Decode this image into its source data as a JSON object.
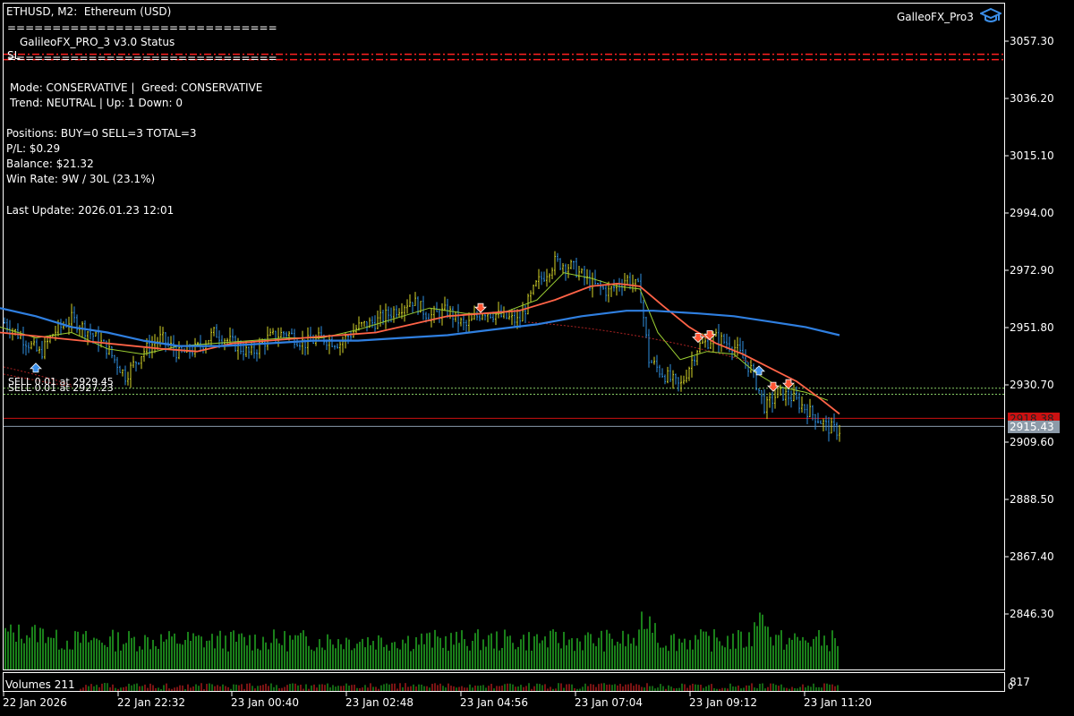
{
  "window": {
    "symbol_title": "ETHUSD, M2:  Ethereum (USD)",
    "ea_name": "GalleoFX_Pro3"
  },
  "status_panel": {
    "sep_top": "==============================",
    "title": "GalileoFX_PRO_3 v3.0 Status",
    "sl_marker": "SL",
    "sep_bottom": "==============================",
    "mode_line": "Mode: CONSERVATIVE |  Greed: CONSERVATIVE",
    "trend_line": "Trend: NEUTRAL | Up: 1 Down: 0",
    "positions_line": "Positions: BUY=0 SELL=3 TOTAL=3",
    "pl_line": "P/L: $0.29",
    "balance_line": "Balance: $21.32",
    "winrate_line": "Win Rate: 9W / 30L (23.1%)",
    "update_line": "Last Update: 2026.01.23 12:01"
  },
  "trade_labels": {
    "line1": "SELL 0.01 at 2929.45",
    "line2": "SELL 0.01 at 2927.23"
  },
  "price_axis": {
    "labels": [
      "3057.30",
      "3036.20",
      "3015.10",
      "2994.00",
      "2972.90",
      "2951.80",
      "2930.70",
      "2909.60",
      "2888.50",
      "2867.40",
      "2846.30"
    ],
    "current_bid": "2915.43",
    "current_ask": "2918.38",
    "volume_scale": "817",
    "volume_zero": "0"
  },
  "time_axis": {
    "labels": [
      "22 Jan 2026",
      "22 Jan 22:32",
      "23 Jan 00:40",
      "23 Jan 02:48",
      "23 Jan 04:56",
      "23 Jan 07:04",
      "23 Jan 09:12",
      "23 Jan 11:20"
    ]
  },
  "volume_panel": {
    "label": "Volumes 211"
  },
  "colors": {
    "bull_bar": "#d4d42a",
    "bear_bar": "#2f8fe0",
    "ma_fast": "#9acd32",
    "ma_mid": "#ff6347",
    "ma_slow": "#2f7fe0",
    "sl_line": "#ff2020",
    "ask_line": "#cc1111",
    "bid_line": "#8899aa",
    "volume_bar": "#22aa22",
    "trade_line": "#88cc66"
  },
  "icons": {
    "ea_icon": "graduation-cap-icon",
    "sell_arrow": "sell-arrow-icon",
    "buy_arrow": "buy-arrow-icon"
  },
  "chart_data": {
    "type": "candlestick",
    "symbol": "ETHUSD",
    "timeframe": "M2",
    "ylim": [
      2836,
      3068
    ],
    "price_ticks": [
      3057.3,
      3036.2,
      3015.1,
      2994.0,
      2972.9,
      2951.8,
      2930.7,
      2909.6,
      2888.5,
      2867.4,
      2846.3
    ],
    "anchors": [
      [
        0,
        2955
      ],
      [
        25,
        2948
      ],
      [
        45,
        2942
      ],
      [
        60,
        2950
      ],
      [
        80,
        2955
      ],
      [
        100,
        2950
      ],
      [
        120,
        2944
      ],
      [
        140,
        2934
      ],
      [
        160,
        2943
      ],
      [
        180,
        2948
      ],
      [
        200,
        2942
      ],
      [
        220,
        2944
      ],
      [
        240,
        2950
      ],
      [
        260,
        2946
      ],
      [
        280,
        2942
      ],
      [
        300,
        2948
      ],
      [
        320,
        2950
      ],
      [
        340,
        2946
      ],
      [
        360,
        2948
      ],
      [
        380,
        2946
      ],
      [
        400,
        2952
      ],
      [
        420,
        2954
      ],
      [
        440,
        2958
      ],
      [
        460,
        2962
      ],
      [
        480,
        2956
      ],
      [
        500,
        2958
      ],
      [
        520,
        2952
      ],
      [
        540,
        2958
      ],
      [
        560,
        2956
      ],
      [
        580,
        2954
      ],
      [
        600,
        2968
      ],
      [
        620,
        2976
      ],
      [
        640,
        2974
      ],
      [
        660,
        2968
      ],
      [
        680,
        2965
      ],
      [
        700,
        2970
      ],
      [
        715,
        2966
      ],
      [
        725,
        2940
      ],
      [
        740,
        2935
      ],
      [
        760,
        2930
      ],
      [
        780,
        2945
      ],
      [
        800,
        2948
      ],
      [
        820,
        2945
      ],
      [
        840,
        2936
      ],
      [
        855,
        2922
      ],
      [
        870,
        2928
      ],
      [
        885,
        2926
      ],
      [
        900,
        2922
      ],
      [
        915,
        2918
      ],
      [
        925,
        2915
      ],
      [
        935,
        2914
      ]
    ],
    "ma_fast_points": [
      [
        0,
        2952
      ],
      [
        40,
        2948
      ],
      [
        80,
        2950
      ],
      [
        120,
        2944
      ],
      [
        160,
        2942
      ],
      [
        200,
        2945
      ],
      [
        240,
        2946
      ],
      [
        280,
        2947
      ],
      [
        320,
        2948
      ],
      [
        360,
        2948
      ],
      [
        400,
        2951
      ],
      [
        440,
        2955
      ],
      [
        480,
        2959
      ],
      [
        520,
        2957
      ],
      [
        560,
        2957
      ],
      [
        600,
        2962
      ],
      [
        630,
        2972
      ],
      [
        660,
        2970
      ],
      [
        690,
        2967
      ],
      [
        715,
        2966
      ],
      [
        735,
        2950
      ],
      [
        760,
        2940
      ],
      [
        790,
        2943
      ],
      [
        820,
        2942
      ],
      [
        845,
        2935
      ],
      [
        870,
        2930
      ],
      [
        900,
        2928
      ],
      [
        925,
        2925
      ]
    ],
    "ma_mid_points": [
      [
        0,
        2950
      ],
      [
        60,
        2948
      ],
      [
        120,
        2946
      ],
      [
        180,
        2944
      ],
      [
        220,
        2943
      ],
      [
        260,
        2946
      ],
      [
        300,
        2947
      ],
      [
        340,
        2948
      ],
      [
        380,
        2949
      ],
      [
        420,
        2950
      ],
      [
        460,
        2953
      ],
      [
        500,
        2956
      ],
      [
        540,
        2957
      ],
      [
        580,
        2958
      ],
      [
        620,
        2962
      ],
      [
        660,
        2967
      ],
      [
        690,
        2968
      ],
      [
        715,
        2967
      ],
      [
        740,
        2960
      ],
      [
        770,
        2952
      ],
      [
        800,
        2946
      ],
      [
        830,
        2942
      ],
      [
        860,
        2937
      ],
      [
        890,
        2932
      ],
      [
        915,
        2926
      ],
      [
        938,
        2920
      ]
    ],
    "ma_slow_points": [
      [
        0,
        2959
      ],
      [
        40,
        2956
      ],
      [
        80,
        2952
      ],
      [
        120,
        2950
      ],
      [
        160,
        2947
      ],
      [
        200,
        2945
      ],
      [
        250,
        2945
      ],
      [
        300,
        2946
      ],
      [
        350,
        2947
      ],
      [
        400,
        2947
      ],
      [
        450,
        2948
      ],
      [
        500,
        2949
      ],
      [
        550,
        2951
      ],
      [
        600,
        2953
      ],
      [
        650,
        2956
      ],
      [
        700,
        2958
      ],
      [
        730,
        2958
      ],
      [
        780,
        2957
      ],
      [
        820,
        2956
      ],
      [
        860,
        2954
      ],
      [
        900,
        2952
      ],
      [
        938,
        2949
      ]
    ],
    "sl_level": 3051.5,
    "ask_level": 2918.38,
    "bid_level": 2915.43,
    "trade_levels": [
      2929.45,
      2927.23
    ],
    "sell_signals": [
      [
        537,
        2958
      ],
      [
        780,
        2947
      ],
      [
        793,
        2948
      ],
      [
        864,
        2929
      ],
      [
        881,
        2930
      ]
    ],
    "buy_signals": [
      [
        40,
        2938
      ],
      [
        848,
        2937
      ]
    ],
    "volume_max": 817
  }
}
